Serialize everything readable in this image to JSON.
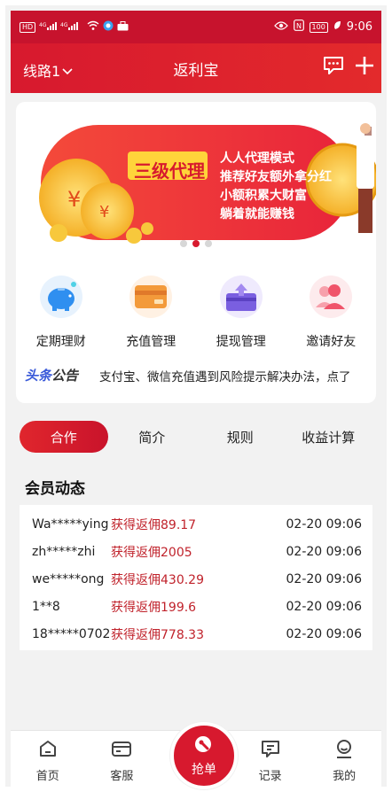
{
  "status_bar": {
    "network_left": "HD 4G 4G",
    "time": "9:06",
    "battery": "100"
  },
  "header": {
    "route_label": "线路1",
    "title": "返利宝"
  },
  "banner": {
    "badge": "三级代理",
    "lines": [
      "人人代理模式",
      "推荐好友额外拿分红",
      "小额积累大财富",
      "躺着就能赚钱"
    ],
    "currency": "¥"
  },
  "features": [
    {
      "label": "定期理财",
      "icon": "piggy-bank-icon",
      "color": "#2f8ff0"
    },
    {
      "label": "充值管理",
      "icon": "card-icon",
      "color": "#f39a3a"
    },
    {
      "label": "提现管理",
      "icon": "withdraw-icon",
      "color": "#7a5fe0"
    },
    {
      "label": "邀请好友",
      "icon": "invite-friends-icon",
      "color": "#f0546a"
    }
  ],
  "notice": {
    "tag_part1": "头条",
    "tag_part2": "公告",
    "text": "支付宝、微信充值遇到风险提示解决办法，点了"
  },
  "tabs": [
    "合作",
    "简介",
    "规则",
    "收益计算"
  ],
  "member_section": {
    "title": "会员动态",
    "rows": [
      {
        "user": "Wa*****ying",
        "reward": "获得返佣89.17",
        "time": "02-20 09:06"
      },
      {
        "user": "zh*****zhi",
        "reward": "获得返佣2005",
        "time": "02-20 09:06"
      },
      {
        "user": "we*****ong",
        "reward": "获得返佣430.29",
        "time": "02-20 09:06"
      },
      {
        "user": "1**8",
        "reward": "获得返佣199.6",
        "time": "02-20 09:06"
      },
      {
        "user": "18*****0702",
        "reward": "获得返佣778.33",
        "time": "02-20 09:06"
      }
    ]
  },
  "bottom_nav": {
    "home": "首页",
    "service": "客服",
    "grab": "抢单",
    "records": "记录",
    "mine": "我的"
  },
  "colors": {
    "brand": "#d7192e",
    "reward_text": "#c0222b"
  }
}
